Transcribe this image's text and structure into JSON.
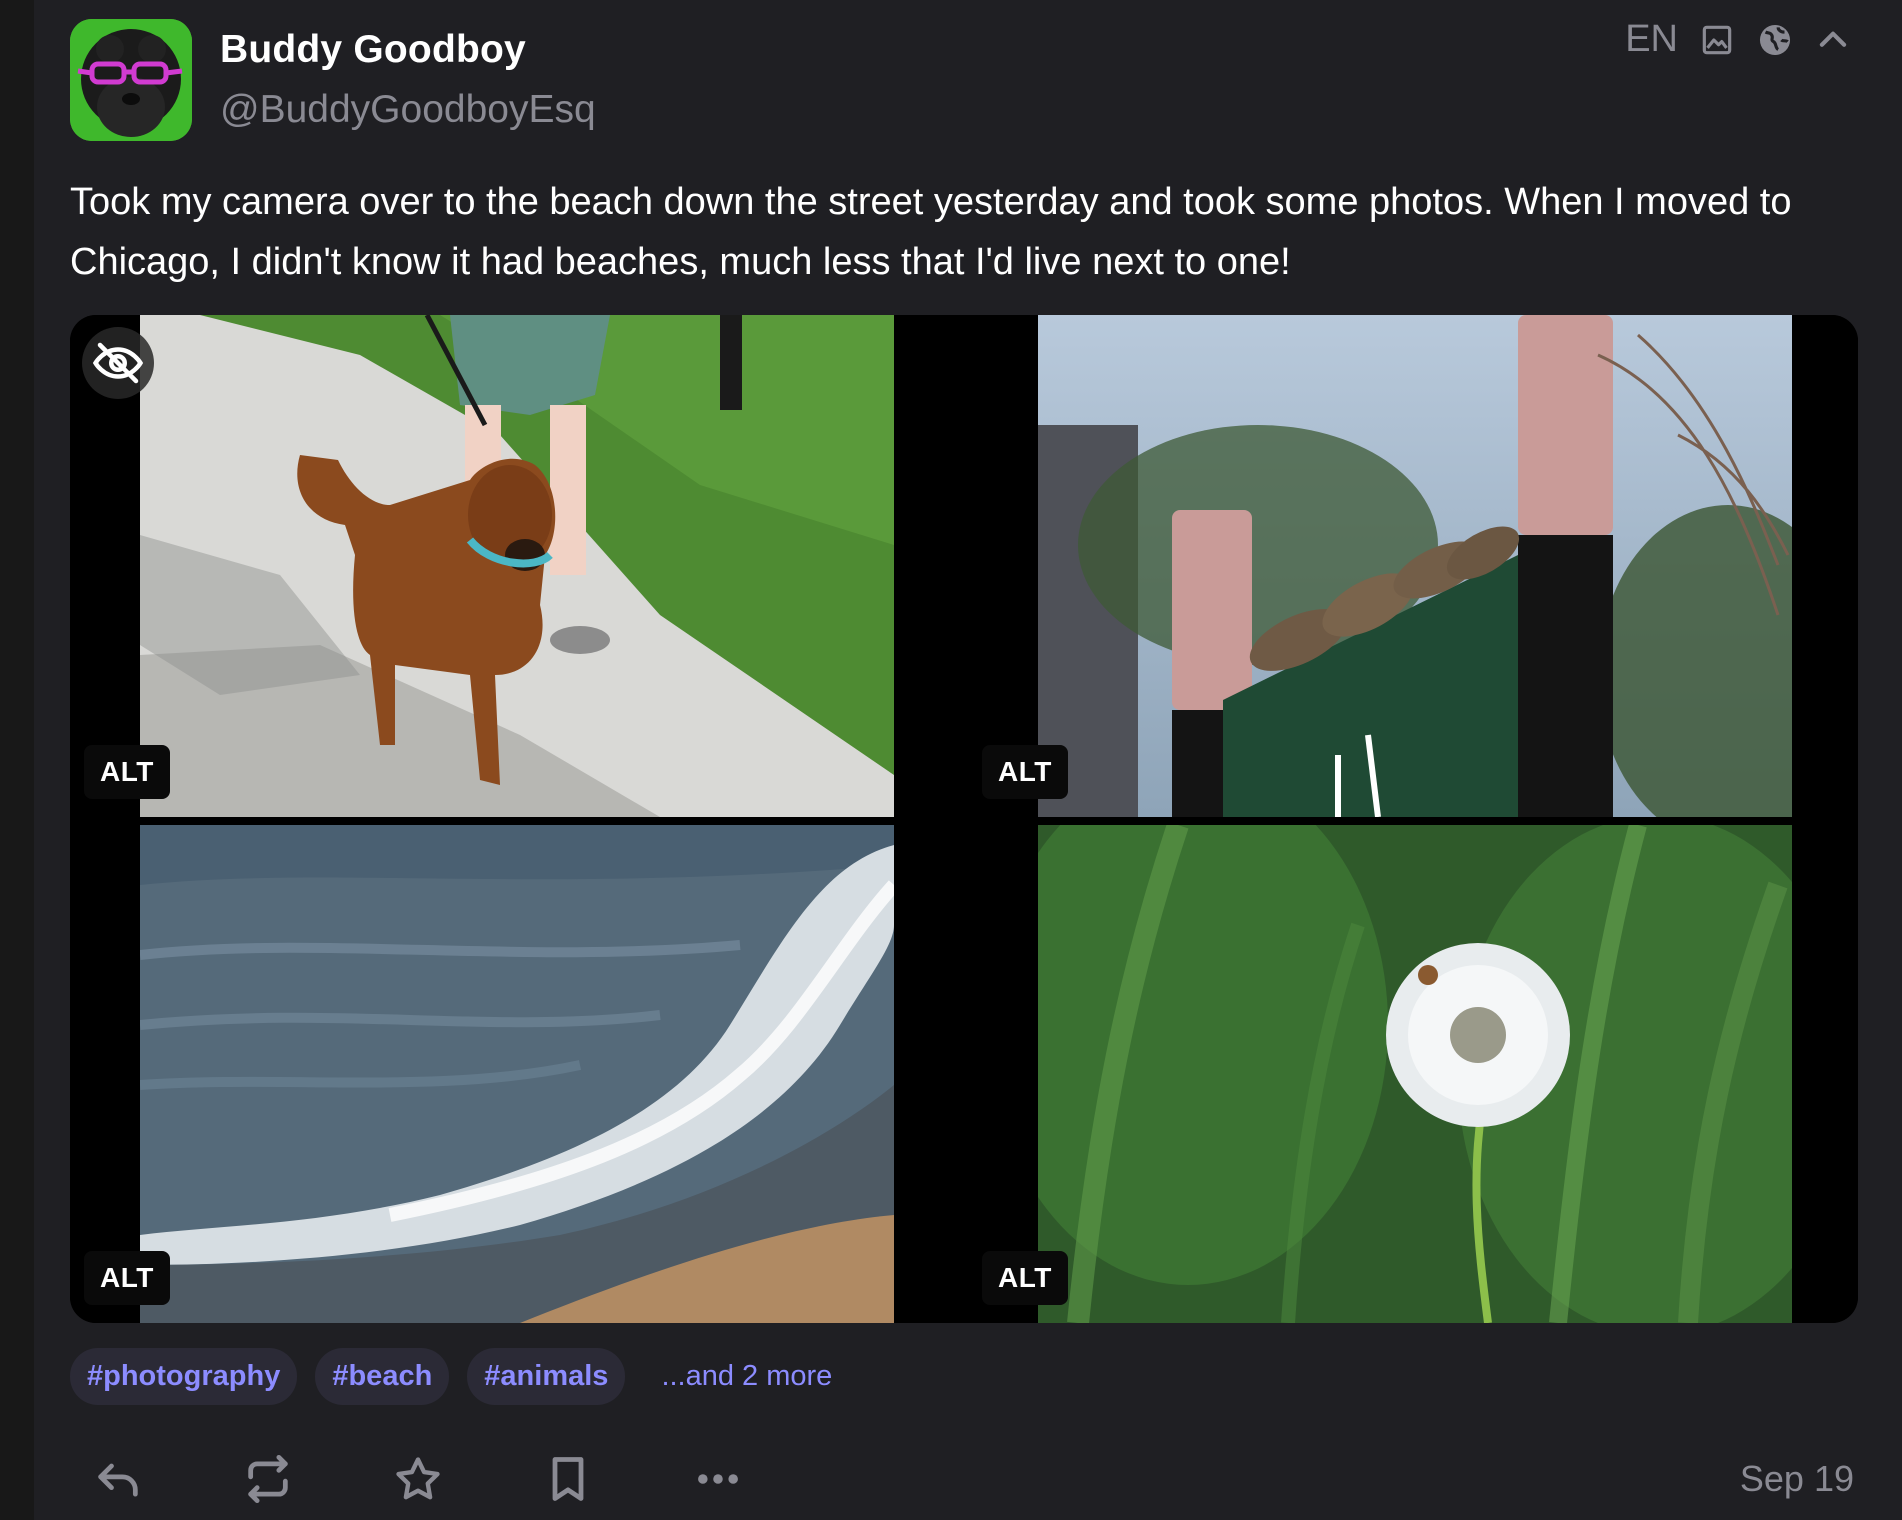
{
  "author": {
    "display_name": "Buddy Goodboy",
    "handle": "@BuddyGoodboyEsq"
  },
  "meta": {
    "language": "EN",
    "icons": [
      "image-icon",
      "globe-icon",
      "collapse-chevron-up-icon"
    ]
  },
  "post": {
    "text": "Took my camera over to the beach down the street yesterday and took some photos. When I moved to Chicago, I didn't know it had beaches, much less that I'd live next to one!"
  },
  "media": [
    {
      "alt_label": "ALT",
      "subject": "dog-walking-photo"
    },
    {
      "alt_label": "ALT",
      "subject": "sparrows-on-sign-photo"
    },
    {
      "alt_label": "ALT",
      "subject": "lake-wave-photo"
    },
    {
      "alt_label": "ALT",
      "subject": "dandelion-photo"
    }
  ],
  "tags": [
    "#photography",
    "#beach",
    "#animals"
  ],
  "more_tags": "...and 2 more",
  "actions": [
    "reply-icon",
    "boost-icon",
    "favourite-icon",
    "bookmark-icon",
    "more-icon"
  ],
  "timestamp": "Sep 19",
  "colors": {
    "background": "#1f1f23",
    "accent": "#8c8cff",
    "tag_bg": "#2b2a36",
    "muted": "#8a8a93"
  }
}
